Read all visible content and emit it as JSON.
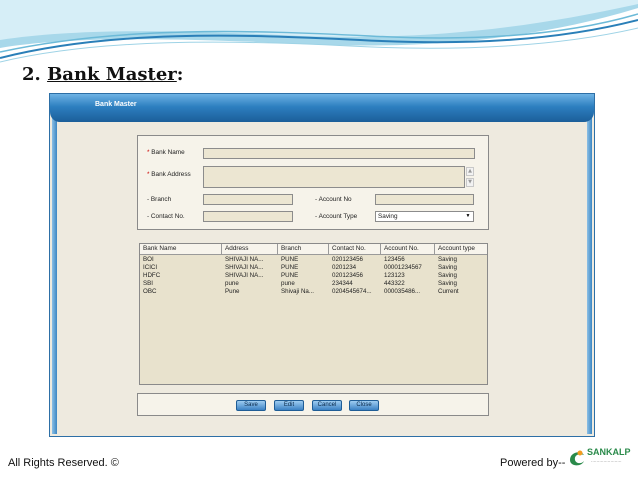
{
  "slide": {
    "number": "2.",
    "title": "Bank  Master",
    "colon": ":",
    "footer_left": "All Rights Reserved. ©",
    "footer_right": "Powered by--",
    "logo_text": "SANKALP",
    "logo_sub": "......................"
  },
  "window": {
    "title": "Bank Master"
  },
  "form": {
    "bank_name_label": "Bank Name",
    "bank_address_label": "Bank Address",
    "branch_label": "Branch",
    "account_no_label": "Account No",
    "contact_no_label": "Contact No.",
    "account_type_label": "Account Type",
    "account_type_value": "Saving",
    "required_mark": "*",
    "bullet": "-"
  },
  "grid": {
    "columns": [
      "Bank Name",
      "Address",
      "Branch",
      "Contact No.",
      "Account No.",
      "Account type"
    ],
    "rows": [
      [
        "BOI",
        "SHIVAJI NA...",
        "PUNE",
        "020123456",
        "123456",
        "Saving"
      ],
      [
        "ICICI",
        "SHIVAJI NA...",
        "PUNE",
        "0201234",
        "00001234567",
        "Saving"
      ],
      [
        "HDFC",
        "SHIVAJI NA...",
        "PUNE",
        "020123456",
        "123123",
        "Saving"
      ],
      [
        "SBI",
        "pune",
        "pune",
        "234344",
        "443322",
        "Saving"
      ],
      [
        "OBC",
        "Pune",
        "Shivaji Na...",
        "0204545674...",
        "000035486...",
        "Current"
      ]
    ]
  },
  "buttons": {
    "save": "Save",
    "edit": "Edit",
    "cancel": "Cancel",
    "close": "Close"
  },
  "colors": {
    "titlebar": "#2d7fc0",
    "window_bg": "#eeeadf",
    "input_bg": "#ece6d2"
  }
}
